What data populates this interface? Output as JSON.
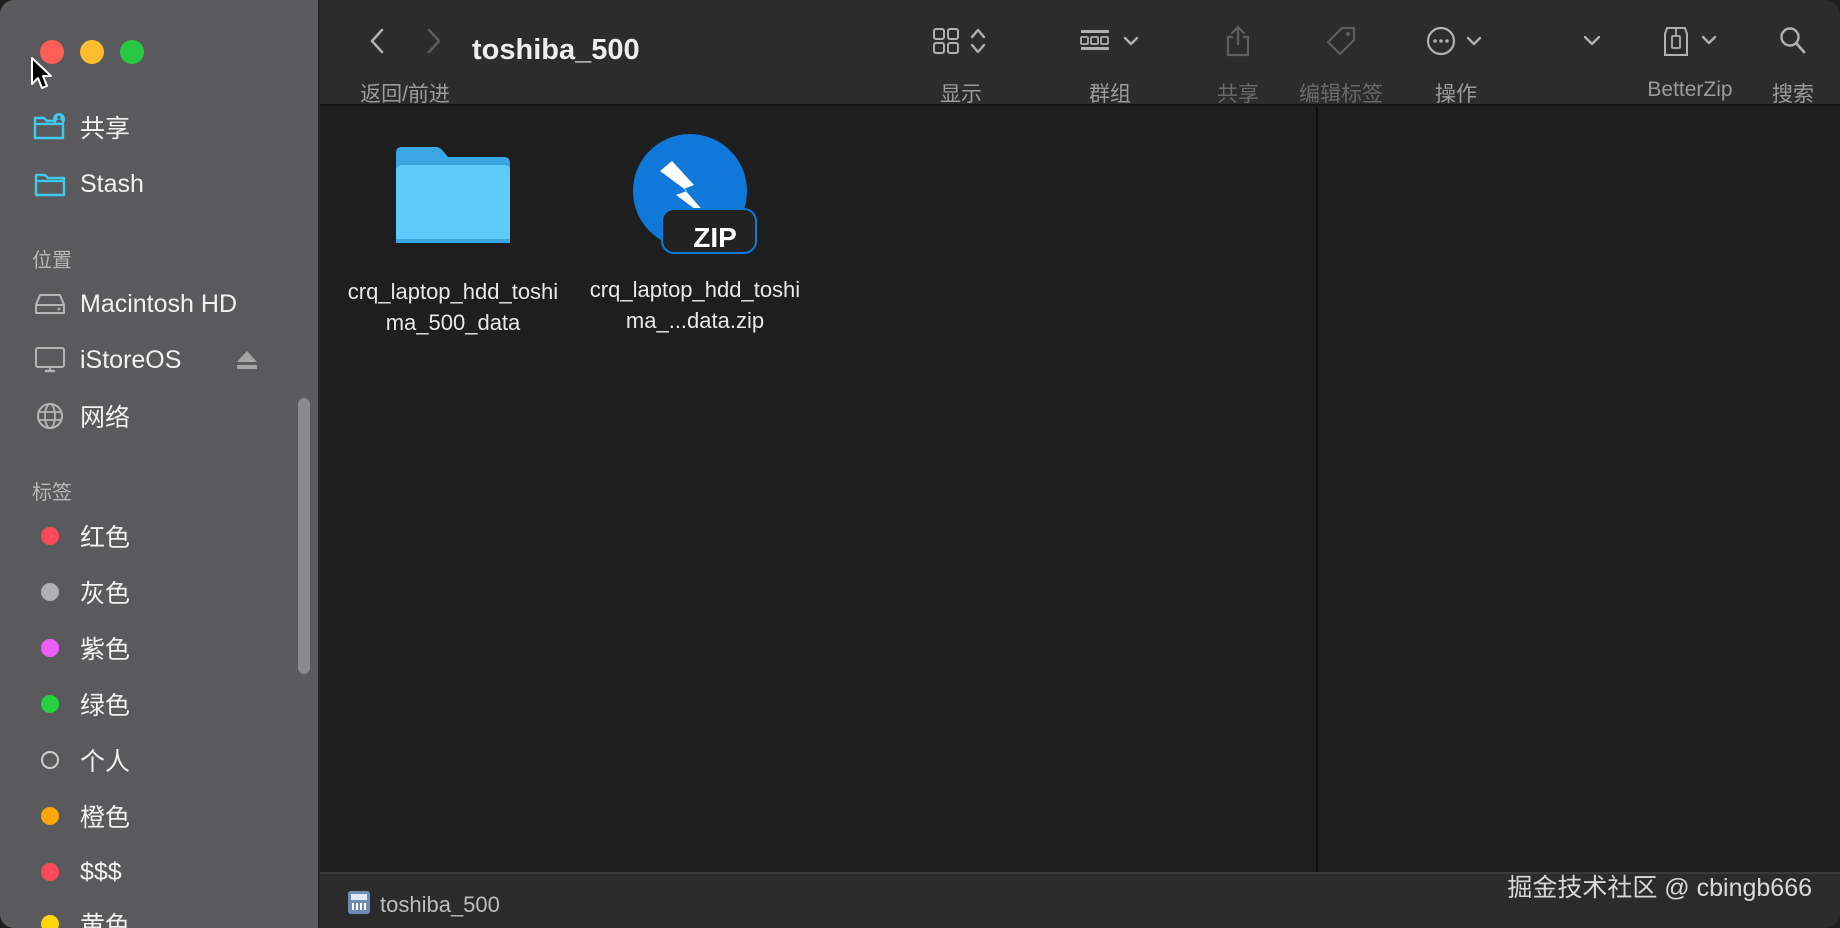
{
  "window": {
    "title": "toshiba_500"
  },
  "sidebar": {
    "items_top": [
      {
        "label": "共享",
        "icon": "shared-folder-icon"
      },
      {
        "label": "Stash",
        "icon": "folder-icon"
      }
    ],
    "locations_header": "位置",
    "locations": [
      {
        "label": "Macintosh HD",
        "icon": "hard-drive-icon"
      },
      {
        "label": "iStoreOS",
        "icon": "display-icon"
      },
      {
        "label": "网络",
        "icon": "globe-icon"
      }
    ],
    "tags_header": "标签",
    "tags": [
      {
        "label": "红色",
        "color": "#fe4a5a"
      },
      {
        "label": "灰色",
        "color": "#b0b0b2"
      },
      {
        "label": "紫色",
        "color": "#ef5ef7"
      },
      {
        "label": "绿色",
        "color": "#27d43f"
      },
      {
        "label": "个人",
        "color": "none"
      },
      {
        "label": "橙色",
        "color": "#ffa60a"
      },
      {
        "label": "$$$",
        "color": "#fe4a5a"
      },
      {
        "label": "黄色",
        "color": "#fed60a"
      }
    ]
  },
  "toolbar": {
    "back_forward_label": "返回/前进",
    "view_label": "显示",
    "group_label": "群组",
    "share_label": "共享",
    "edit_tags_label": "编辑标签",
    "action_label": "操作",
    "betterzip_label": "BetterZip",
    "search_label": "搜索"
  },
  "files": [
    {
      "name": "crq_laptop_hdd_toshima_500_data",
      "type": "folder"
    },
    {
      "name": "crq_laptop_hdd_toshima_...data.zip",
      "type": "zip",
      "badge": "ZIP"
    }
  ],
  "pathbar": {
    "path": "toshiba_500"
  },
  "watermark": "掘金技术社区 @ cbingb666"
}
